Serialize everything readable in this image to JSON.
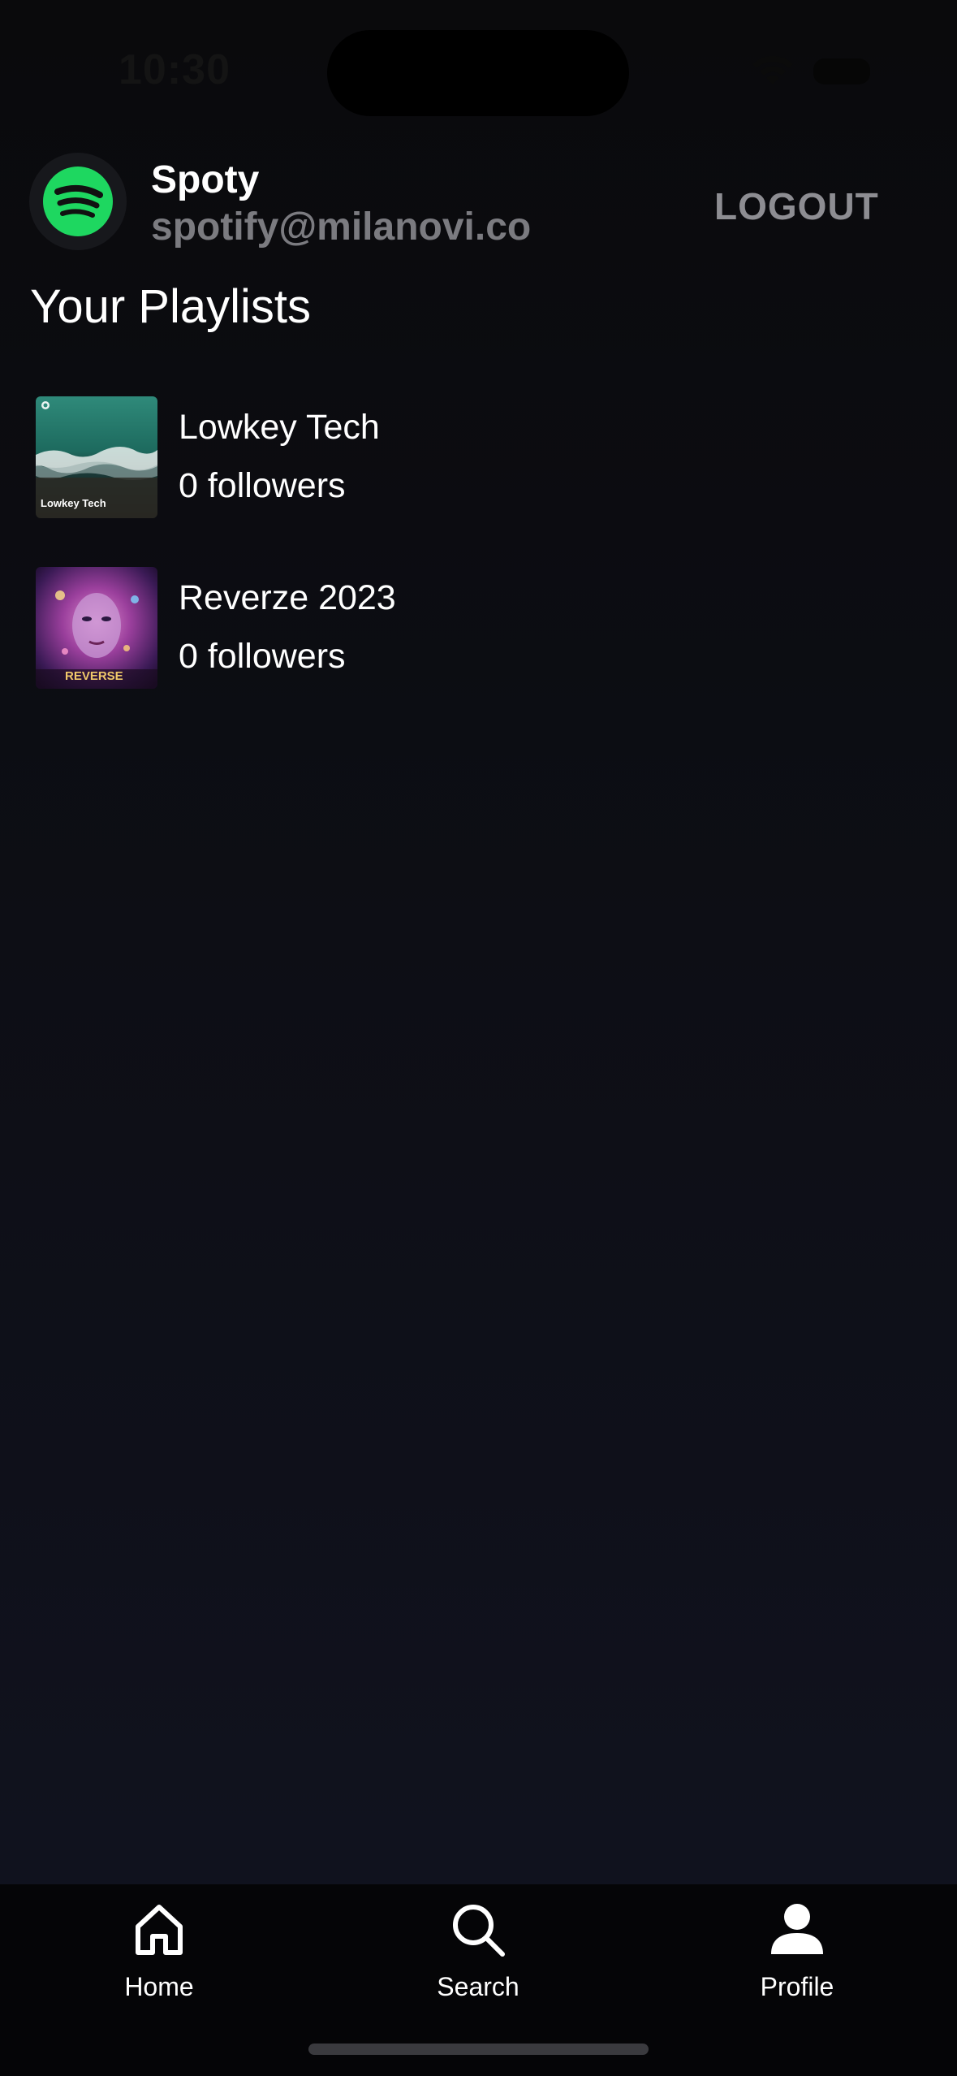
{
  "status_bar": {
    "time": "10:30"
  },
  "header": {
    "avatar_icon": "spotify-logo-icon",
    "user_name": "Spoty",
    "user_email": "spotify@milanovi.co",
    "logout_label": "LOGOUT"
  },
  "colors": {
    "accent_green": "#1ed760",
    "email_gray": "#7b7b80",
    "logout_gray": "#8d8d92"
  },
  "section": {
    "title": "Your Playlists"
  },
  "playlists": [
    {
      "name": "Lowkey Tech",
      "followers": "0 followers",
      "cover_caption": "Lowkey Tech"
    },
    {
      "name": "Reverze 2023",
      "followers": "0 followers",
      "cover_caption": "REVERSE"
    }
  ],
  "tab_bar": {
    "tabs": [
      {
        "label": "Home",
        "icon": "home-icon"
      },
      {
        "label": "Search",
        "icon": "search-icon"
      },
      {
        "label": "Profile",
        "icon": "profile-icon"
      }
    ],
    "active_tab": "Profile"
  }
}
